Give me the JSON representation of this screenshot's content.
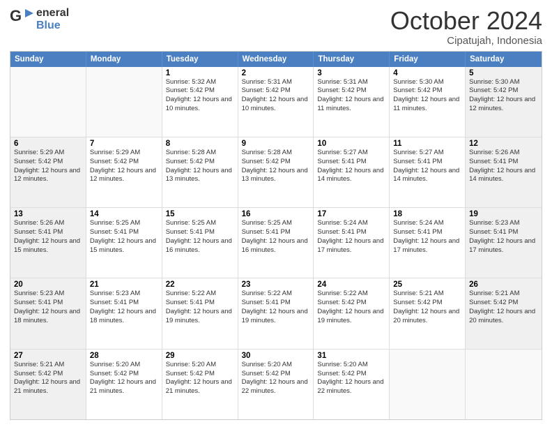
{
  "logo": {
    "line1": "General",
    "line2": "Blue"
  },
  "title": "October 2024",
  "subtitle": "Cipatujah, Indonesia",
  "days_of_week": [
    "Sunday",
    "Monday",
    "Tuesday",
    "Wednesday",
    "Thursday",
    "Friday",
    "Saturday"
  ],
  "weeks": [
    [
      {
        "day": "",
        "info": ""
      },
      {
        "day": "",
        "info": ""
      },
      {
        "day": "1",
        "info": "Sunrise: 5:32 AM\nSunset: 5:42 PM\nDaylight: 12 hours and 10 minutes."
      },
      {
        "day": "2",
        "info": "Sunrise: 5:31 AM\nSunset: 5:42 PM\nDaylight: 12 hours and 10 minutes."
      },
      {
        "day": "3",
        "info": "Sunrise: 5:31 AM\nSunset: 5:42 PM\nDaylight: 12 hours and 11 minutes."
      },
      {
        "day": "4",
        "info": "Sunrise: 5:30 AM\nSunset: 5:42 PM\nDaylight: 12 hours and 11 minutes."
      },
      {
        "day": "5",
        "info": "Sunrise: 5:30 AM\nSunset: 5:42 PM\nDaylight: 12 hours and 12 minutes."
      }
    ],
    [
      {
        "day": "6",
        "info": "Sunrise: 5:29 AM\nSunset: 5:42 PM\nDaylight: 12 hours and 12 minutes."
      },
      {
        "day": "7",
        "info": "Sunrise: 5:29 AM\nSunset: 5:42 PM\nDaylight: 12 hours and 12 minutes."
      },
      {
        "day": "8",
        "info": "Sunrise: 5:28 AM\nSunset: 5:42 PM\nDaylight: 12 hours and 13 minutes."
      },
      {
        "day": "9",
        "info": "Sunrise: 5:28 AM\nSunset: 5:42 PM\nDaylight: 12 hours and 13 minutes."
      },
      {
        "day": "10",
        "info": "Sunrise: 5:27 AM\nSunset: 5:41 PM\nDaylight: 12 hours and 14 minutes."
      },
      {
        "day": "11",
        "info": "Sunrise: 5:27 AM\nSunset: 5:41 PM\nDaylight: 12 hours and 14 minutes."
      },
      {
        "day": "12",
        "info": "Sunrise: 5:26 AM\nSunset: 5:41 PM\nDaylight: 12 hours and 14 minutes."
      }
    ],
    [
      {
        "day": "13",
        "info": "Sunrise: 5:26 AM\nSunset: 5:41 PM\nDaylight: 12 hours and 15 minutes."
      },
      {
        "day": "14",
        "info": "Sunrise: 5:25 AM\nSunset: 5:41 PM\nDaylight: 12 hours and 15 minutes."
      },
      {
        "day": "15",
        "info": "Sunrise: 5:25 AM\nSunset: 5:41 PM\nDaylight: 12 hours and 16 minutes."
      },
      {
        "day": "16",
        "info": "Sunrise: 5:25 AM\nSunset: 5:41 PM\nDaylight: 12 hours and 16 minutes."
      },
      {
        "day": "17",
        "info": "Sunrise: 5:24 AM\nSunset: 5:41 PM\nDaylight: 12 hours and 17 minutes."
      },
      {
        "day": "18",
        "info": "Sunrise: 5:24 AM\nSunset: 5:41 PM\nDaylight: 12 hours and 17 minutes."
      },
      {
        "day": "19",
        "info": "Sunrise: 5:23 AM\nSunset: 5:41 PM\nDaylight: 12 hours and 17 minutes."
      }
    ],
    [
      {
        "day": "20",
        "info": "Sunrise: 5:23 AM\nSunset: 5:41 PM\nDaylight: 12 hours and 18 minutes."
      },
      {
        "day": "21",
        "info": "Sunrise: 5:23 AM\nSunset: 5:41 PM\nDaylight: 12 hours and 18 minutes."
      },
      {
        "day": "22",
        "info": "Sunrise: 5:22 AM\nSunset: 5:41 PM\nDaylight: 12 hours and 19 minutes."
      },
      {
        "day": "23",
        "info": "Sunrise: 5:22 AM\nSunset: 5:41 PM\nDaylight: 12 hours and 19 minutes."
      },
      {
        "day": "24",
        "info": "Sunrise: 5:22 AM\nSunset: 5:42 PM\nDaylight: 12 hours and 19 minutes."
      },
      {
        "day": "25",
        "info": "Sunrise: 5:21 AM\nSunset: 5:42 PM\nDaylight: 12 hours and 20 minutes."
      },
      {
        "day": "26",
        "info": "Sunrise: 5:21 AM\nSunset: 5:42 PM\nDaylight: 12 hours and 20 minutes."
      }
    ],
    [
      {
        "day": "27",
        "info": "Sunrise: 5:21 AM\nSunset: 5:42 PM\nDaylight: 12 hours and 21 minutes."
      },
      {
        "day": "28",
        "info": "Sunrise: 5:20 AM\nSunset: 5:42 PM\nDaylight: 12 hours and 21 minutes."
      },
      {
        "day": "29",
        "info": "Sunrise: 5:20 AM\nSunset: 5:42 PM\nDaylight: 12 hours and 21 minutes."
      },
      {
        "day": "30",
        "info": "Sunrise: 5:20 AM\nSunset: 5:42 PM\nDaylight: 12 hours and 22 minutes."
      },
      {
        "day": "31",
        "info": "Sunrise: 5:20 AM\nSunset: 5:42 PM\nDaylight: 12 hours and 22 minutes."
      },
      {
        "day": "",
        "info": ""
      },
      {
        "day": "",
        "info": ""
      }
    ]
  ]
}
